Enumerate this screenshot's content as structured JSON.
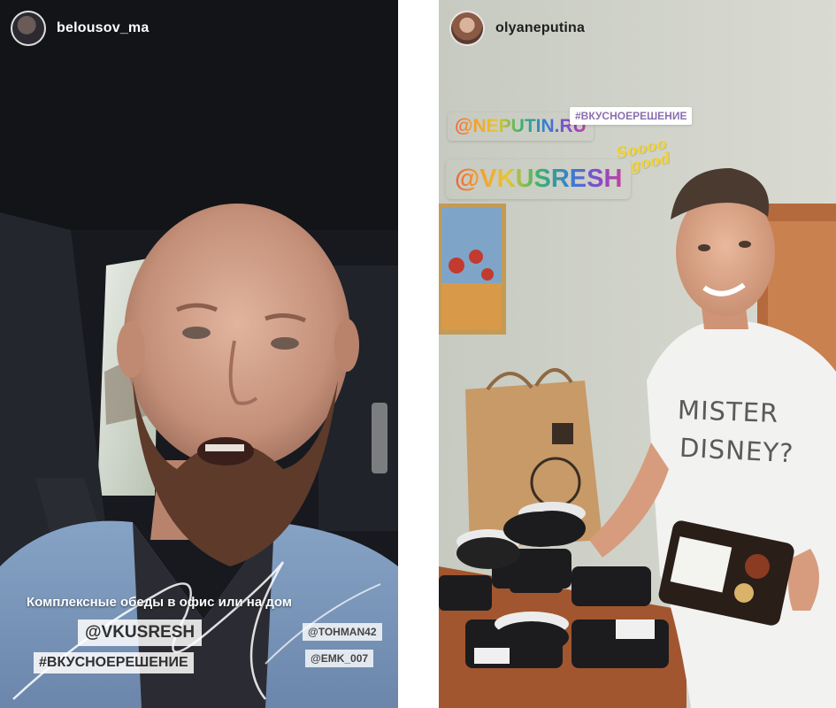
{
  "stories": {
    "left": {
      "username": "belousov_ma",
      "caption": "Комплексные обеды в офис или на дом",
      "main_tag": "@VKUSRESH",
      "hashtag": "#ВКУСНОЕРЕШЕНИЕ",
      "mentions": [
        "@TOHMAN42",
        "@EMK_007"
      ]
    },
    "right": {
      "username": "olyaneputina",
      "mention_1": "@NEPUTIN.RU",
      "hashtag": "#ВКУСНОЕРЕШЕНИЕ",
      "mention_2": "@VKUSRESH",
      "sticker": [
        "Soooo",
        "good"
      ],
      "shirt_text": [
        "MISTER",
        "DISNEY?"
      ]
    }
  },
  "icons": {
    "left_avatar": "avatar",
    "right_avatar": "avatar"
  },
  "colors": {
    "sticker_yellow": "#f1d33a",
    "left_bg": "#1a1c22",
    "right_bg": "#cfd2c9"
  }
}
